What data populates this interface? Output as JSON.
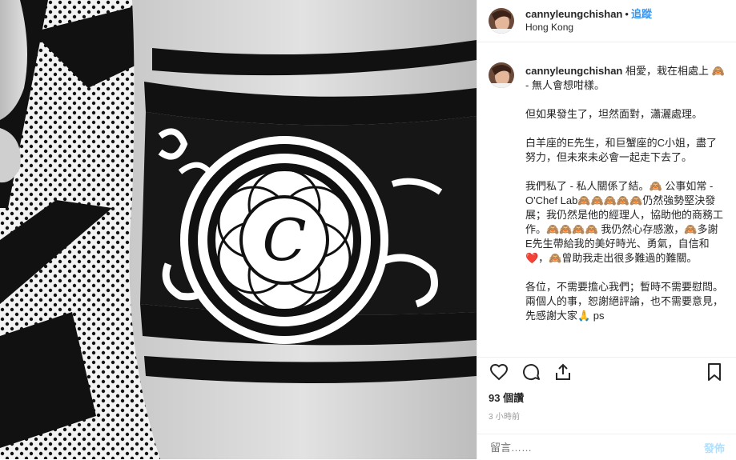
{
  "post": {
    "username": "cannyleungchishan",
    "separator": "•",
    "follow_label": "追蹤",
    "location": "Hong Kong",
    "caption_paragraphs": [
      "相愛，栽在相處上 🙈 - 無人會想咁樣。",
      "但如果發生了，坦然面對，瀟灑處理。",
      "白羊座的E先生，和巨蟹座的C小姐，盡了努力，但未來未必會一起走下去了。",
      "我們私了 - 私人關係了結。🙈 公事如常 - O'Chef Lab🙈🙈🙈🙈🙈仍然強勢堅決發展；我仍然是他的經理人，協助他的商務工作。🙈🙈🙈🙈 我仍然心存感激，🙈多謝E先生帶給我的美好時光、勇氣，自信和❤️，🙈曾助我走出很多難過的難關。",
      "各位，不需要擔心我們；暫時不需要慰問。兩個人的事，恕謝絕評論，也不需要意見，先感謝大家🙏 ps"
    ],
    "likes": "93 個讚",
    "time_ago": "3 小時前",
    "comment_placeholder": "留言……",
    "post_label": "發佈"
  },
  "photo": {
    "tattoo_letter": "C"
  },
  "icons": [
    "heart-icon",
    "comment-icon",
    "share-icon",
    "bookmark-icon"
  ],
  "colors": {
    "link": "#3897f0",
    "post_disabled": "#b2dffc",
    "muted": "#999999",
    "text": "#262626"
  }
}
